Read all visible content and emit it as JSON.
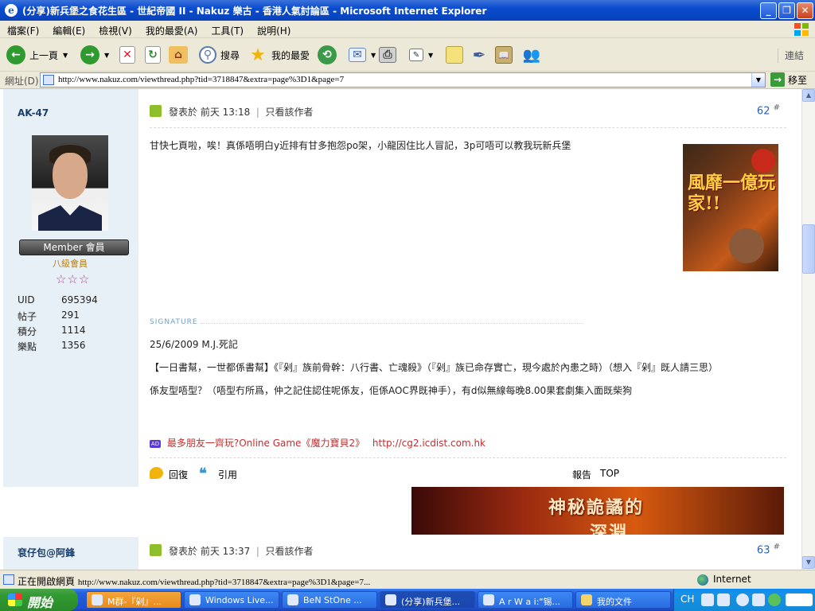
{
  "window": {
    "title": "(分享)新兵堡之食花生區 - 世紀帝國 II - Nakuz 樂古 - 香港人氣討論區 - Microsoft Internet Explorer",
    "minimize": "_",
    "maximize": "❐",
    "close": "✕"
  },
  "menu": {
    "items": [
      "檔案(F)",
      "編輯(E)",
      "檢視(V)",
      "我的最愛(A)",
      "工具(T)",
      "說明(H)"
    ]
  },
  "toolbar": {
    "back": "上一頁",
    "search": "搜尋",
    "favorites": "我的最愛",
    "links": "連結"
  },
  "address": {
    "label": "網址(D)",
    "url": "http://www.nakuz.com/viewthread.php?tid=3718847&extra=page%3D1&page=7",
    "go": "移至"
  },
  "post1": {
    "author": "AK-47",
    "member_badge": "Member 會員",
    "rank": "八級會員",
    "stars": "☆☆☆",
    "stats": [
      {
        "label": "UID",
        "value": "695394"
      },
      {
        "label": "帖子",
        "value": "291"
      },
      {
        "label": "積分",
        "value": "1114"
      },
      {
        "label": "樂點",
        "value": "1356"
      }
    ],
    "posted": "發表於 前天 13:18",
    "sep": "|",
    "author_only": "只看該作者",
    "floor": "62",
    "floor_mark": "#",
    "message": "甘快七頁啦，唉！真係唔明白y近排有甘多抱怨po架，小龍因住比人冒記，3p可唔可以教我玩新兵堡",
    "side_ad_text": "風靡一億玩家!!",
    "signature_label": "SIGNATURE",
    "signature": [
      "25/6/2009 M.J.死記",
      "【一日書幫，一世都係書幫】《『剁』族前骨幹：八行書、亡魂殺》（『剁』族已命存實亡，現今處於內患之時）（想入『剁』既人請三思）",
      "係友型唔型？（唔型冇所爲，仲之記住認住呢係友，佢係AOC界既神手），有d似無線每晚8.00果套劇集入面既柴狗"
    ],
    "ad_badge": "AD",
    "ad_text": "最多朋友一齊玩?Online Game《魔力寶貝2》",
    "ad_url": "http://cg2.icdist.com.hk",
    "reply": "回復",
    "quote": "引用",
    "report": "報告",
    "top": "TOP",
    "banner_text": "神秘詭譎的",
    "banner_text2": "深淵"
  },
  "post2": {
    "author": "袞仔包@阿鋒",
    "posted": "發表於 前天 13:37",
    "sep": "|",
    "author_only": "只看該作者",
    "floor": "63",
    "floor_mark": "#"
  },
  "status": {
    "text": "正在開啟網頁",
    "url": "http://www.nakuz.com/viewthread.php?tid=3718847&extra=page%3D1&page=7...",
    "zone": "Internet"
  },
  "taskbar": {
    "start": "開始",
    "tasks": [
      "M群-『剁』...",
      "Windows Live...",
      "BeN StOne ...",
      "(分享)新兵堡...",
      "A r W a i:\"锡...",
      "我的文件"
    ],
    "lang": "CH"
  }
}
